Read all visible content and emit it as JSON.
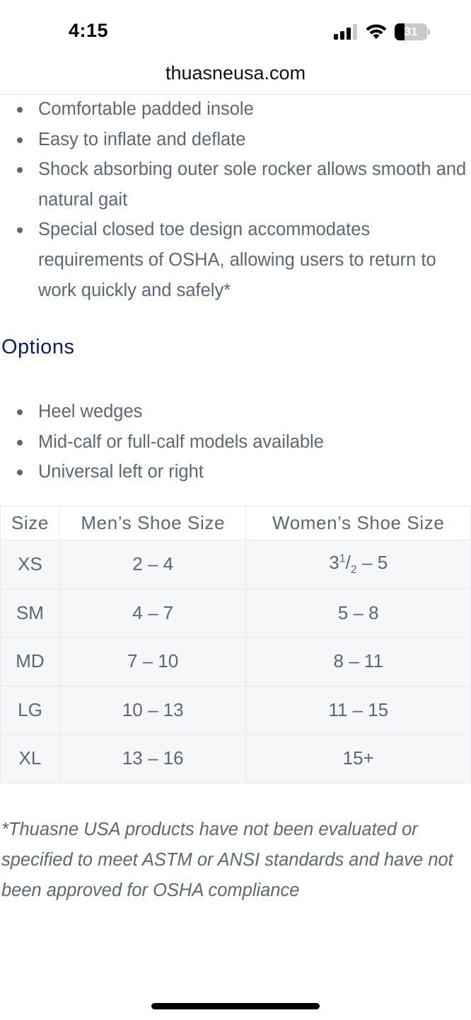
{
  "status_bar": {
    "time": "4:15",
    "battery_level": "31",
    "battery_fraction": 0.31,
    "signal_bars": 3,
    "icons": [
      "cellular-signal-icon",
      "wifi-icon",
      "battery-icon"
    ]
  },
  "browser": {
    "url": "thuasneusa.com"
  },
  "features": [
    "Comfortable padded insole",
    "Easy to inflate and deflate",
    "Shock absorbing outer sole rocker allows smooth and natural gait",
    "Special closed toe design accommodates requirements of OSHA, allowing users to return to work quickly and safely*"
  ],
  "options": {
    "heading": "Options",
    "items": [
      "Heel wedges",
      "Mid-calf or full-calf models available",
      "Universal left or right"
    ]
  },
  "size_table": {
    "headers": [
      "Size",
      "Men’s Shoe Size",
      "Women’s Shoe Size"
    ],
    "rows": [
      {
        "size": "XS",
        "mens": "2 – 4",
        "womens_whole": "3",
        "womens_num": "1",
        "womens_den": "2",
        "womens_rest": " – 5"
      },
      {
        "size": "SM",
        "mens": "4 – 7",
        "womens": "5 – 8"
      },
      {
        "size": "MD",
        "mens": "7 – 10",
        "womens": "8 – 11"
      },
      {
        "size": "LG",
        "mens": "10 – 13",
        "womens": "11 – 15"
      },
      {
        "size": "XL",
        "mens": "13 – 16",
        "womens": "15+"
      }
    ]
  },
  "disclaimer": "*Thuasne USA products have not been evaluated or specified to meet ASTM or ANSI standards and have not been approved for OSHA compliance",
  "colors": {
    "heading": "#0f1a6e",
    "body_text": "#5d6774",
    "table_row_bg": "#f6f7f9",
    "table_border": "#e6e8ec"
  }
}
